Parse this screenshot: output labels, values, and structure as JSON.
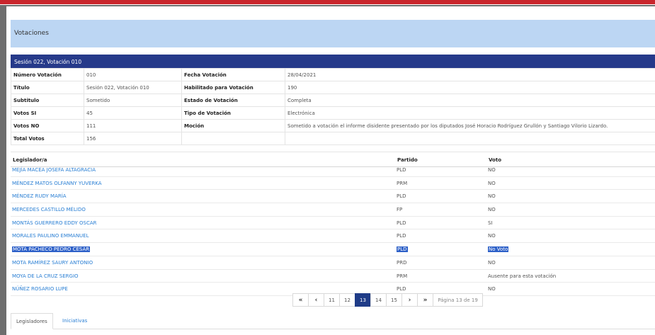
{
  "modal": {
    "title": "Votaciones"
  },
  "section": {
    "title": "Sesión 022, Votación 010"
  },
  "details": {
    "numero_label": "Número Votación",
    "numero_value": "010",
    "fecha_label": "Fecha Votación",
    "fecha_value": "28/04/2021",
    "titulo_label": "Título",
    "titulo_value": "Sesión 022, Votación 010",
    "habilitado_label": "Habilitado para Votación",
    "habilitado_value": "190",
    "subtitulo_label": "Subtitulo",
    "subtitulo_value": "Sometido",
    "estado_label": "Estado de Votación",
    "estado_value": "Completa",
    "si_label": "Votos SI",
    "si_value": "45",
    "tipo_label": "Tipo de Votación",
    "tipo_value": "Electrónica",
    "no_label": "Votos NO",
    "no_value": "111",
    "mocion_label": "Moción",
    "mocion_value": "Sometido a votación el informe disidente presentado por los diputados José Horacio Rodríguez Grullón y Santiago Vilorio Lizardo.",
    "total_label": "Total Votos",
    "total_value": "156"
  },
  "legislators": {
    "col_name": "Legislador/a",
    "col_party": "Partido",
    "col_vote": "Voto",
    "rows": [
      {
        "name": "MEJÍA MACEA JOSEFA ALTAGRACIA",
        "party": "PLD",
        "vote": "NO"
      },
      {
        "name": "MÉNDEZ MATOS OLFANNY YUVERKA",
        "party": "PRM",
        "vote": "NO"
      },
      {
        "name": "MÉNDEZ RUDY MARÍA",
        "party": "PLD",
        "vote": "NO"
      },
      {
        "name": "MERCEDES CASTILLO MÉLIDO",
        "party": "FP",
        "vote": "NO"
      },
      {
        "name": "MONTÁS GUERRERO EDDY OSCAR",
        "party": "PLD",
        "vote": "SI"
      },
      {
        "name": "MORALES PAULINO EMMANUEL",
        "party": "PLD",
        "vote": "NO"
      },
      {
        "name": "MOTA PACHECO PEDRO CÉSAR",
        "party": "PLD",
        "vote": "No Voto"
      },
      {
        "name": "MOTA RAMÍREZ SAURY ANTONIO",
        "party": "PRD",
        "vote": "NO"
      },
      {
        "name": "MOYA DE LA CRUZ SERGIO",
        "party": "PRM",
        "vote": "Ausente para esta votación"
      },
      {
        "name": "NÚÑEZ ROSARIO LUPE",
        "party": "PLD",
        "vote": "NO"
      }
    ]
  },
  "pagination": {
    "first": "«",
    "prev": "‹",
    "next": "›",
    "last": "»",
    "pages": [
      "11",
      "12",
      "13",
      "14",
      "15"
    ],
    "current": "13",
    "info": "Página 13 de 19"
  },
  "tabs": {
    "legisladores": "Legisladores",
    "iniciativas": "Iniciativas"
  },
  "colors": {
    "header_bg": "#bcd6f3",
    "section_bar": "#263a8a",
    "link": "#2a7fd4",
    "active_page": "#1f3c88",
    "selection": "#2d60c8"
  }
}
